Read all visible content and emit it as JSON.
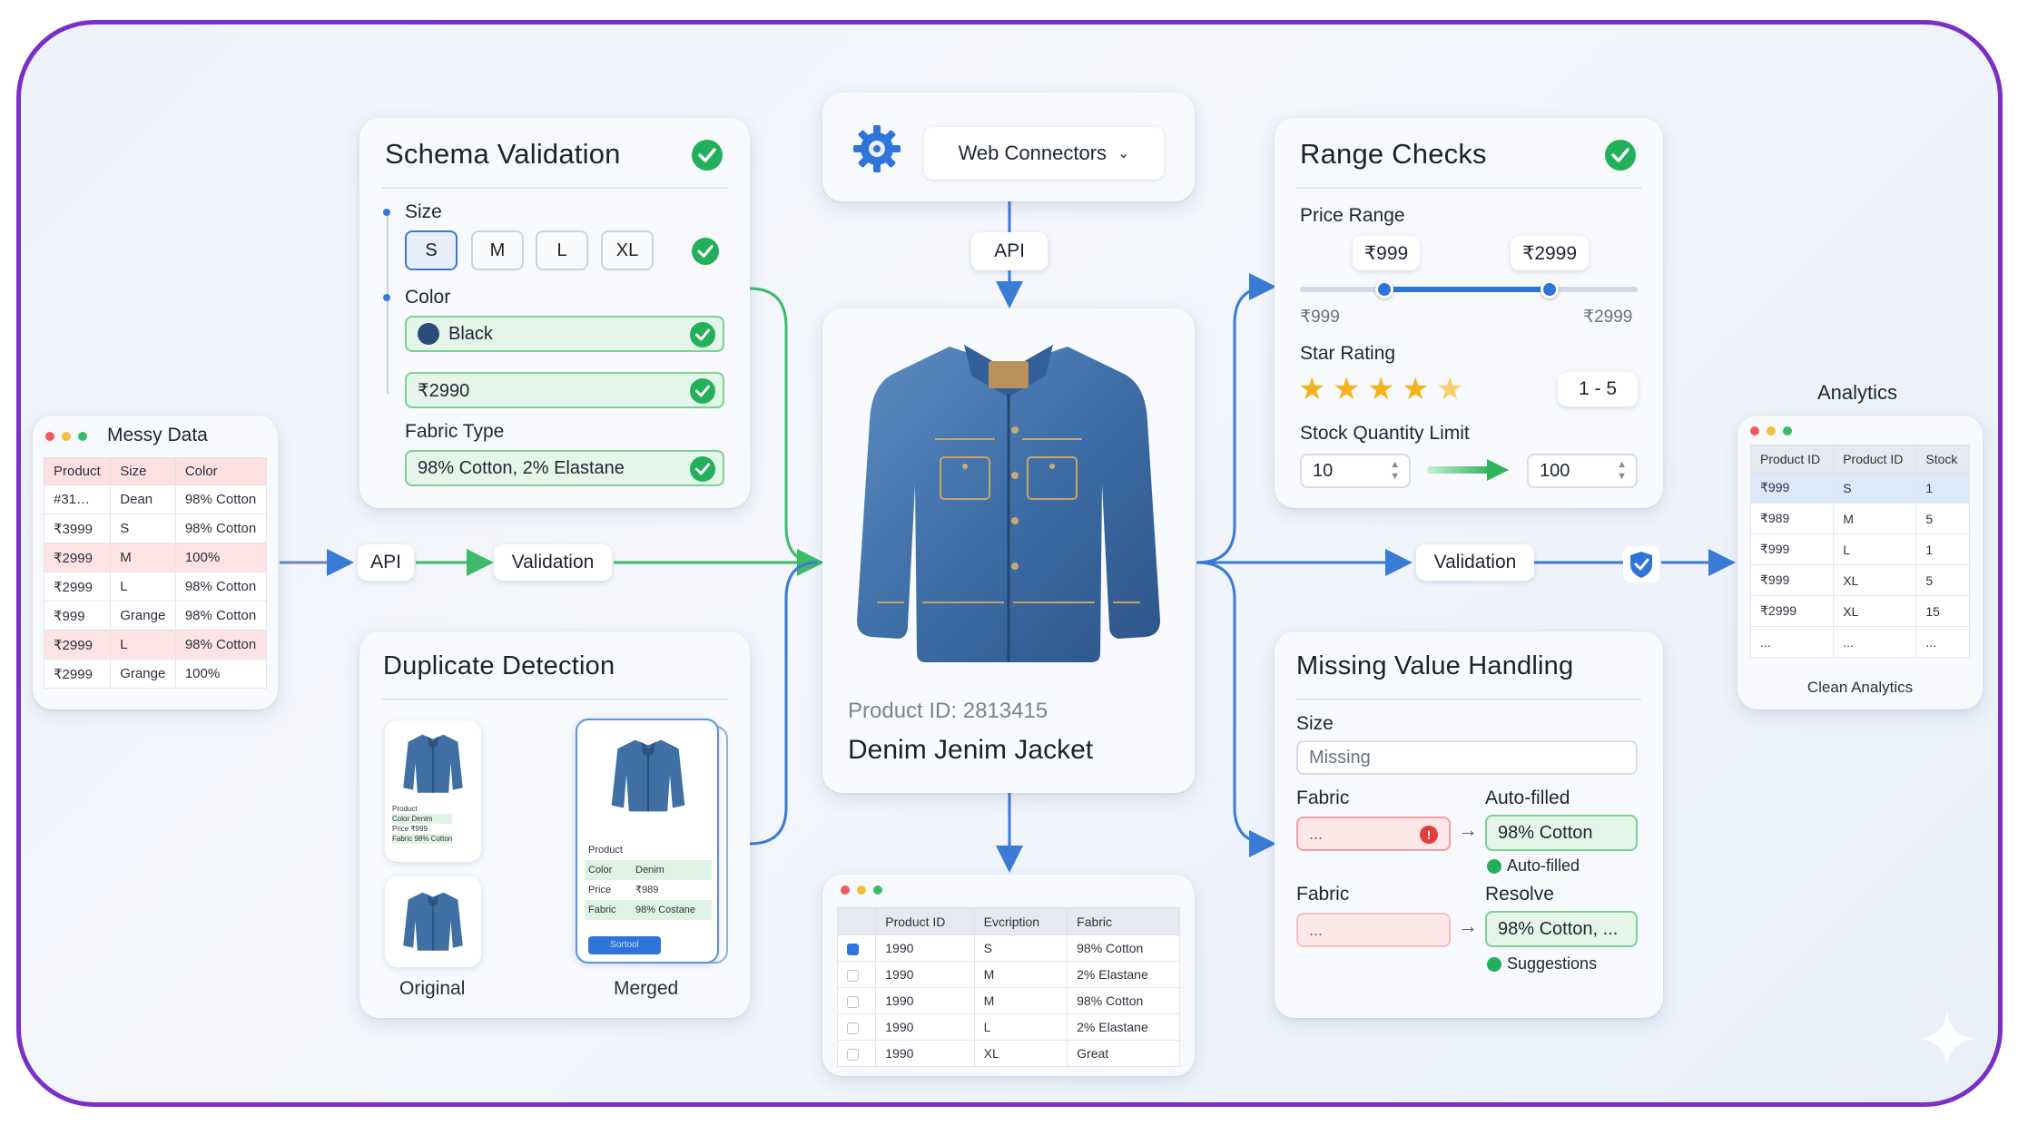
{
  "colors": {
    "frame_border": "#7b2fc9",
    "flow_blue": "#3a7bd5",
    "flow_green": "#3dbb6a",
    "check_green": "#22b05a",
    "error_red": "#e53b3b",
    "star_gold": "#f6b21b"
  },
  "messy_data": {
    "title": "Messy Data",
    "columns": [
      "Product",
      "Size",
      "Color"
    ],
    "rows": [
      [
        "#31…",
        "Dean",
        "98% Cotton"
      ],
      [
        "₹3999",
        "S",
        "98% Cotton"
      ],
      [
        "₹2999",
        "M",
        "100%"
      ],
      [
        "₹2999",
        "L",
        "98% Cotton"
      ],
      [
        "₹999",
        "Grange",
        "98% Cotton"
      ],
      [
        "₹2999",
        "L",
        "98% Cotton"
      ],
      [
        "₹2999",
        "Grange",
        "100%"
      ]
    ],
    "highlighted_rows": [
      2,
      5
    ]
  },
  "flow": {
    "api_label": "API",
    "validation_label": "Validation",
    "top_api_label": "API",
    "right_validation_label": "Validation"
  },
  "schema_validation": {
    "title": "Schema Validation",
    "size_label": "Size",
    "sizes": [
      "S",
      "M",
      "L",
      "XL"
    ],
    "selected_size": "S",
    "color_label": "Color",
    "color_value": "Black",
    "price_value": "₹2990",
    "fabric_label": "Fabric Type",
    "fabric_value": "98% Cotton, 2% Elastane",
    "icons": [
      "check-circle-icon"
    ]
  },
  "duplicate_detection": {
    "title": "Duplicate Detection",
    "original_label": "Original",
    "merged_label": "Merged",
    "thumb_lines": [
      "Product",
      "Color   Denim",
      "Price   ₹999",
      "Fabric   98% Cotton"
    ],
    "merged_rows": [
      [
        "Product",
        ""
      ],
      [
        "Color",
        "Denim"
      ],
      [
        "Price",
        "₹989"
      ],
      [
        "Fabric",
        "98% Costane"
      ]
    ],
    "merged_button": "Sortool"
  },
  "connectors": {
    "gear_icon": "gear-icon",
    "dropdown_label": "Web Connectors"
  },
  "product": {
    "image_icon": "denim-jacket-image",
    "id_text": "Product ID: 2813415",
    "name": "Denim Jenim Jacket"
  },
  "bottom_table": {
    "columns": [
      "",
      "Product ID",
      "Evcription",
      "Fabric"
    ],
    "rows": [
      [
        true,
        "1990",
        "S",
        "98% Cotton"
      ],
      [
        false,
        "1990",
        "M",
        "2% Elastane"
      ],
      [
        false,
        "1990",
        "M",
        "98% Cotton"
      ],
      [
        false,
        "1990",
        "L",
        "2% Elastane"
      ],
      [
        false,
        "1990",
        "XL",
        "Great"
      ]
    ]
  },
  "range_checks": {
    "title": "Range Checks",
    "price_label": "Price Range",
    "price_min_box": "₹999",
    "price_max_box": "₹2999",
    "price_min_axis": "₹999",
    "price_max_axis": "₹2999",
    "slider_low_fraction": 0.25,
    "slider_high_fraction": 0.74,
    "rating_label": "Star Rating",
    "rating_value": 4.5,
    "rating_max": 5,
    "rating_range": "1 - 5",
    "stock_label": "Stock Quantity Limit",
    "stock_min": "10",
    "stock_max": "100"
  },
  "missing_value": {
    "title": "Missing Value Handling",
    "size_label": "Size",
    "size_placeholder": "Missing",
    "fabric_label_1": "Fabric",
    "fabric_error_value": "...",
    "autofilled_label": "Auto-filled",
    "autofilled_value": "98% Cotton",
    "autofilled_status": "Auto-filled",
    "fabric_label_2": "Fabric",
    "fabric_value_2": "...",
    "resolve_label": "Resolve",
    "resolve_value": "98% Cotton, ...",
    "resolve_status": "Suggestions",
    "arrow_glyph": "→"
  },
  "analytics": {
    "title": "Analytics",
    "columns": [
      "Product ID",
      "Product ID",
      "Stock"
    ],
    "rows": [
      [
        "₹999",
        "S",
        "1"
      ],
      [
        "₹989",
        "M",
        "5"
      ],
      [
        "₹999",
        "L",
        "1"
      ],
      [
        "₹999",
        "XL",
        "5"
      ],
      [
        "₹2999",
        "XL",
        "15"
      ],
      [
        "...",
        "...",
        "..."
      ]
    ],
    "footer": "Clean Analytics"
  }
}
